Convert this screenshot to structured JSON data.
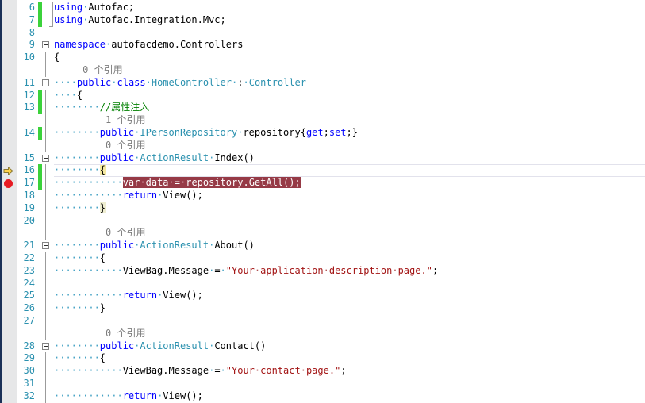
{
  "editor": {
    "language": "csharp",
    "codelens_suffix": "个引用",
    "colors": {
      "keyword": "#0000ff",
      "type": "#2b91af",
      "string": "#a31515",
      "comment": "#008000",
      "whitespace_dot": "#44a2c4",
      "line_number": "#2b91af",
      "breakpoint_line_bg": "#963a46",
      "breakpoint_dot": "#e61b23",
      "current_arrow": "#ffd34a",
      "change_bar": "#3bd23b",
      "brace_match_active": "#f5e9a1",
      "brace_match_pair": "#eeedd0",
      "indicator_margin_bg": "#e6e7e8",
      "window_edge": "#1a3057"
    },
    "rows": [
      {
        "type": "code",
        "num": "6",
        "bar": true,
        "out": "ubr",
        "segs": [
          [
            "kw",
            "using"
          ],
          [
            "ws",
            "·"
          ],
          [
            "id",
            "Autofac;"
          ]
        ]
      },
      {
        "type": "code",
        "num": "7",
        "bar": true,
        "out": "ubr ufoot",
        "segs": [
          [
            "kw",
            "using"
          ],
          [
            "ws",
            "·"
          ],
          [
            "id",
            "Autofac.Integration.Mvc;"
          ]
        ]
      },
      {
        "type": "code",
        "num": "8",
        "segs": []
      },
      {
        "type": "code",
        "num": "9",
        "out": "box",
        "segs": [
          [
            "kw",
            "namespace"
          ],
          [
            "ws",
            "·"
          ],
          [
            "id",
            "autofacdemo.Controllers"
          ]
        ]
      },
      {
        "type": "code",
        "num": "10",
        "out": "guide",
        "segs": [
          [
            "id",
            "{"
          ]
        ]
      },
      {
        "type": "codelens",
        "out": "guide",
        "segs": [
          [
            "cl",
            "     0 个引用"
          ]
        ]
      },
      {
        "type": "code",
        "num": "11",
        "out": "box",
        "segs": [
          [
            "ws",
            "····"
          ],
          [
            "kw",
            "public"
          ],
          [
            "ws",
            "·"
          ],
          [
            "kw",
            "class"
          ],
          [
            "ws",
            "·"
          ],
          [
            "ty",
            "HomeController"
          ],
          [
            "ws",
            "·"
          ],
          [
            "id",
            ":"
          ],
          [
            "ws",
            "·"
          ],
          [
            "ty",
            "Controller"
          ]
        ]
      },
      {
        "type": "code",
        "num": "12",
        "bar": true,
        "out": "guide",
        "segs": [
          [
            "ws",
            "····"
          ],
          [
            "id",
            "{"
          ]
        ]
      },
      {
        "type": "code",
        "num": "13",
        "bar": true,
        "out": "guide",
        "segs": [
          [
            "ws",
            "········"
          ],
          [
            "cm",
            "//属性注入"
          ]
        ]
      },
      {
        "type": "codelens",
        "out": "guide",
        "segs": [
          [
            "cl",
            "         1 个引用"
          ]
        ]
      },
      {
        "type": "code",
        "num": "14",
        "bar": true,
        "out": "guide",
        "segs": [
          [
            "ws",
            "········"
          ],
          [
            "kw",
            "public"
          ],
          [
            "ws",
            "·"
          ],
          [
            "ty",
            "IPersonRepository"
          ],
          [
            "ws",
            "·"
          ],
          [
            "id",
            "repository{"
          ],
          [
            "kw",
            "get"
          ],
          [
            "id",
            ";"
          ],
          [
            "kw",
            "set"
          ],
          [
            "id",
            ";}"
          ]
        ]
      },
      {
        "type": "codelens",
        "out": "guide",
        "segs": [
          [
            "cl",
            "         0 个引用"
          ]
        ]
      },
      {
        "type": "code",
        "num": "15",
        "out": "box",
        "segs": [
          [
            "ws",
            "········"
          ],
          [
            "kw",
            "public"
          ],
          [
            "ws",
            "·"
          ],
          [
            "ty",
            "ActionResult"
          ],
          [
            "ws",
            "·"
          ],
          [
            "id",
            "Index()"
          ]
        ]
      },
      {
        "type": "code",
        "num": "16",
        "bar": true,
        "icon": "current-statement-arrow",
        "current": true,
        "out": "guide",
        "segs": [
          [
            "ws",
            "········"
          ],
          [
            "brY",
            "{"
          ]
        ]
      },
      {
        "type": "code",
        "num": "17",
        "bar": true,
        "icon": "breakpoint",
        "out": "guide",
        "segs": [
          [
            "ws",
            "············"
          ],
          [
            "bp",
            "var"
          ],
          [
            "bpws",
            "·"
          ],
          [
            "bp",
            "data"
          ],
          [
            "bpws",
            "·"
          ],
          [
            "bp",
            "="
          ],
          [
            "bpws",
            "·"
          ],
          [
            "bp",
            "repository.GetAll();"
          ]
        ]
      },
      {
        "type": "code",
        "num": "18",
        "out": "guide",
        "segs": [
          [
            "ws",
            "············"
          ],
          [
            "kw",
            "return"
          ],
          [
            "ws",
            "·"
          ],
          [
            "id",
            "View();"
          ]
        ]
      },
      {
        "type": "code",
        "num": "19",
        "out": "guide",
        "segs": [
          [
            "ws",
            "········"
          ],
          [
            "brG",
            "}"
          ]
        ]
      },
      {
        "type": "code",
        "num": "20",
        "out": "guide",
        "segs": []
      },
      {
        "type": "codelens",
        "out": "guide",
        "segs": [
          [
            "cl",
            "         0 个引用"
          ]
        ]
      },
      {
        "type": "code",
        "num": "21",
        "out": "box",
        "segs": [
          [
            "ws",
            "········"
          ],
          [
            "kw",
            "public"
          ],
          [
            "ws",
            "·"
          ],
          [
            "ty",
            "ActionResult"
          ],
          [
            "ws",
            "·"
          ],
          [
            "id",
            "About()"
          ]
        ]
      },
      {
        "type": "code",
        "num": "22",
        "out": "guide",
        "segs": [
          [
            "ws",
            "········"
          ],
          [
            "id",
            "{"
          ]
        ]
      },
      {
        "type": "code",
        "num": "23",
        "out": "guide",
        "segs": [
          [
            "ws",
            "············"
          ],
          [
            "id",
            "ViewBag.Message"
          ],
          [
            "ws",
            "·"
          ],
          [
            "id",
            "="
          ],
          [
            "ws",
            "·"
          ],
          [
            "st",
            "\"Your"
          ],
          [
            "wss",
            "·"
          ],
          [
            "st",
            "application"
          ],
          [
            "wss",
            "·"
          ],
          [
            "st",
            "description"
          ],
          [
            "wss",
            "·"
          ],
          [
            "st",
            "page.\""
          ],
          [
            "id",
            ";"
          ]
        ]
      },
      {
        "type": "code",
        "num": "24",
        "out": "guide",
        "segs": []
      },
      {
        "type": "code",
        "num": "25",
        "out": "guide",
        "segs": [
          [
            "ws",
            "············"
          ],
          [
            "kw",
            "return"
          ],
          [
            "ws",
            "·"
          ],
          [
            "id",
            "View();"
          ]
        ]
      },
      {
        "type": "code",
        "num": "26",
        "out": "guide",
        "segs": [
          [
            "ws",
            "········"
          ],
          [
            "id",
            "}"
          ]
        ]
      },
      {
        "type": "code",
        "num": "27",
        "out": "guide",
        "segs": []
      },
      {
        "type": "codelens",
        "out": "guide",
        "segs": [
          [
            "cl",
            "         0 个引用"
          ]
        ]
      },
      {
        "type": "code",
        "num": "28",
        "out": "box",
        "segs": [
          [
            "ws",
            "········"
          ],
          [
            "kw",
            "public"
          ],
          [
            "ws",
            "·"
          ],
          [
            "ty",
            "ActionResult"
          ],
          [
            "ws",
            "·"
          ],
          [
            "id",
            "Contact()"
          ]
        ]
      },
      {
        "type": "code",
        "num": "29",
        "out": "guide",
        "segs": [
          [
            "ws",
            "········"
          ],
          [
            "id",
            "{"
          ]
        ]
      },
      {
        "type": "code",
        "num": "30",
        "out": "guide",
        "segs": [
          [
            "ws",
            "············"
          ],
          [
            "id",
            "ViewBag.Message"
          ],
          [
            "ws",
            "·"
          ],
          [
            "id",
            "="
          ],
          [
            "ws",
            "·"
          ],
          [
            "st",
            "\"Your"
          ],
          [
            "wss",
            "·"
          ],
          [
            "st",
            "contact"
          ],
          [
            "wss",
            "·"
          ],
          [
            "st",
            "page.\""
          ],
          [
            "id",
            ";"
          ]
        ]
      },
      {
        "type": "code",
        "num": "31",
        "out": "guide",
        "segs": []
      },
      {
        "type": "code",
        "num": "32",
        "out": "guide",
        "segs": [
          [
            "ws",
            "············"
          ],
          [
            "kw",
            "return"
          ],
          [
            "ws",
            "·"
          ],
          [
            "id",
            "View();"
          ]
        ]
      }
    ]
  }
}
